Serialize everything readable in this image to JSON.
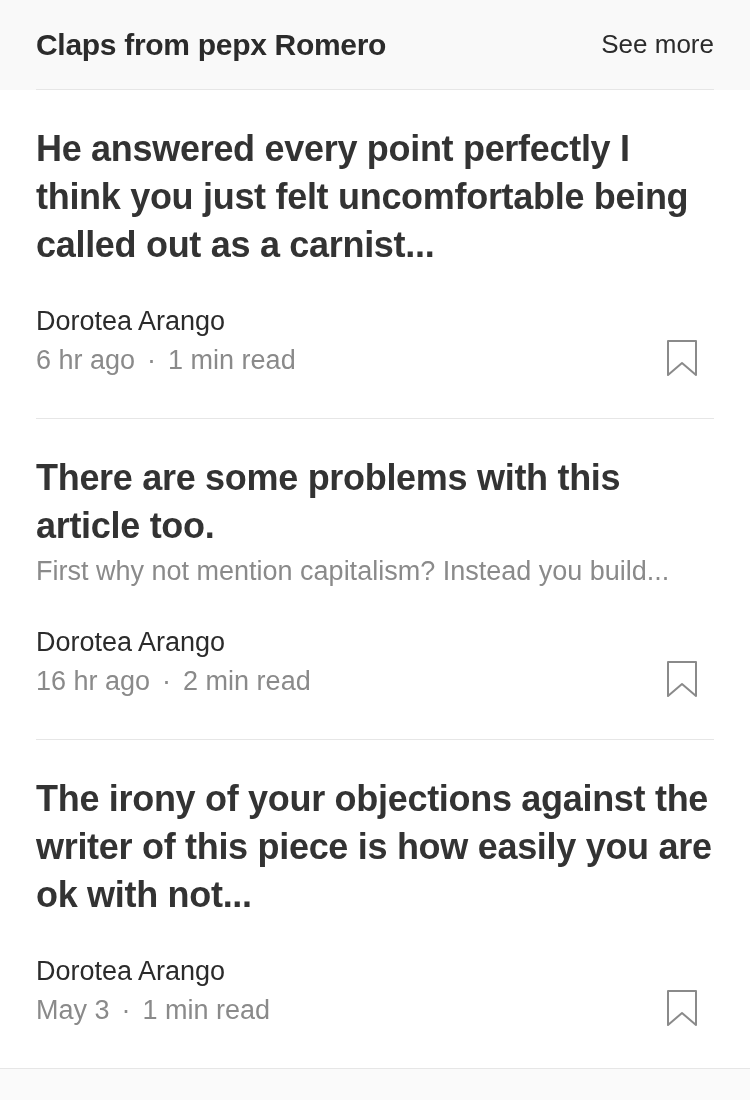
{
  "header": {
    "title": "Claps from pepx Romero",
    "link": "See more"
  },
  "articles": [
    {
      "title": "He answered every point perfectly I think you just felt uncomfortable being called out as a carnist...",
      "author": "Dorotea Arango",
      "time": "6 hr ago",
      "separator": "·",
      "read_time": "1 min read",
      "bookmarked": false
    },
    {
      "title": "There are some problems with this article too.",
      "subtitle": "First why not mention capitalism? Instead you build...",
      "author": "Dorotea Arango",
      "time": "16 hr ago",
      "separator": "·",
      "read_time": "2 min read",
      "bookmarked": false
    },
    {
      "title": "The irony of your objections against the writer of this piece is how easily you are ok with not...",
      "author": "Dorotea Arango",
      "time": "May 3",
      "separator": "·",
      "read_time": "1 min read",
      "bookmarked": false
    }
  ]
}
